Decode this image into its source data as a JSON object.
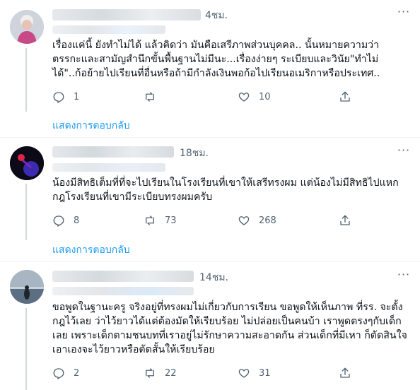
{
  "colors": {
    "accent": "#1d9bf0",
    "muted": "#536471",
    "text": "#0f1419",
    "divider": "#eff3f4"
  },
  "tweets": [
    {
      "time": "4ชม.",
      "text": "เรื่องแค่นี้ ยังทำไม่ได้ แล้วคิดว่า มันคือเสรีภาพส่วนบุคคล.. นั้นหมายความว่า ตรรกะและสามัญสำนึกขั้นพื้นฐานไม่มีนะ...เรื่องง่ายๆ ระเบียบและวินัย\"ทำไม่ได้\"..ก้อย้ายไปเรียนที่อื่นหรือถ้ามีกำลังเงินพอก้อไปเรียนอเมริกาหรือประเทศ..",
      "replies": "1",
      "retweets": "",
      "likes": "10",
      "show_replies": "แสดงการตอบกลับ"
    },
    {
      "time": "18ชม.",
      "text": "น้องมีสิทธิเต็มที่ที่จะไปเรียนในโรงเรียนที่เขาให้เสรีทรงผม แต่น้องไม่มีสิทธิไปแหกกฎโรงเรียนที่เขามีระเบียบทรงผมครับ",
      "replies": "8",
      "retweets": "73",
      "likes": "268",
      "show_replies": "แสดงการตอบกลับ"
    },
    {
      "time": "14ชม.",
      "text": "ขอพูดในฐานะครู จริงอยู่ที่ทรงผมไม่เกี่ยวกับการเรียน ขอพูดให้เห็นภาพ ที่รร. จะตั้งกฎไว้เลย ว่าไว้ยาวได้แต่ต้องมัดให้เรียบร้อย ไม่ปล่อยเป็นคนบ้า เราพูดตรงๆกับเด็กเลย เพราะเด็กตามชนบทที่เราอยู่ไม่รักษาความสะอาดกัน ส่วนเด็กที่มีเหา ก็ตัดสินใจเอาเองจะไว้ยาวหรือตัดสั้นให้เรียบร้อย",
      "replies": "2",
      "retweets": "22",
      "likes": "31",
      "show_replies": ""
    }
  ],
  "icons": [
    "reply-icon",
    "retweet-icon",
    "like-icon",
    "share-icon",
    "more-icon"
  ]
}
